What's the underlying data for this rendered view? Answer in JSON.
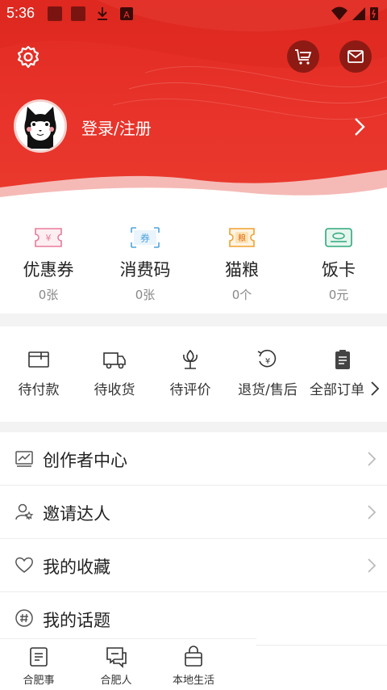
{
  "status_bar": {
    "time": "5:36",
    "notification_icons": [
      "square-icon",
      "square-icon",
      "download-icon",
      "text-a-icon"
    ],
    "system_icons": [
      "wifi-icon",
      "signal-icon",
      "battery-icon"
    ]
  },
  "header": {
    "settings_icon": "gear-icon",
    "cart_icon": "cart-icon",
    "mail_icon": "mail-icon",
    "login_label": "登录/注册",
    "avatar_icon": "cat-avatar",
    "brand_color": "#e8332a"
  },
  "wallet": {
    "items": [
      {
        "label": "优惠券",
        "value": "0张",
        "icon": "coupon-icon",
        "icon_text": "¥",
        "color": "#e97b9a"
      },
      {
        "label": "消费码",
        "value": "0张",
        "icon": "voucher-icon",
        "icon_text": "券",
        "color": "#4fa3dd"
      },
      {
        "label": "猫粮",
        "value": "0个",
        "icon": "catfood-icon",
        "icon_text": "粮",
        "color": "#f0a12f"
      },
      {
        "label": "饭卡",
        "value": "0元",
        "icon": "meal-card-icon",
        "icon_text": "",
        "color": "#2ea87b"
      }
    ]
  },
  "orders": {
    "items": [
      {
        "label": "待付款",
        "icon": "wallet-icon"
      },
      {
        "label": "待收货",
        "icon": "truck-icon"
      },
      {
        "label": "待评价",
        "icon": "flower-icon"
      },
      {
        "label": "退货/售后",
        "icon": "refund-icon"
      },
      {
        "label": "全部订单",
        "icon": "clipboard-icon"
      }
    ]
  },
  "menu": {
    "items": [
      {
        "label": "创作者中心",
        "icon": "chart-icon"
      },
      {
        "label": "邀请达人",
        "icon": "users-icon"
      },
      {
        "label": "我的收藏",
        "icon": "heart-icon"
      },
      {
        "label": "我的话题",
        "icon": "hashtag-icon"
      }
    ]
  },
  "bottom_nav": {
    "items": [
      {
        "label": "合肥事",
        "icon": "news-icon"
      },
      {
        "label": "合肥人",
        "icon": "chat-icon"
      },
      {
        "label": "本地生活",
        "icon": "bag-icon"
      }
    ]
  }
}
